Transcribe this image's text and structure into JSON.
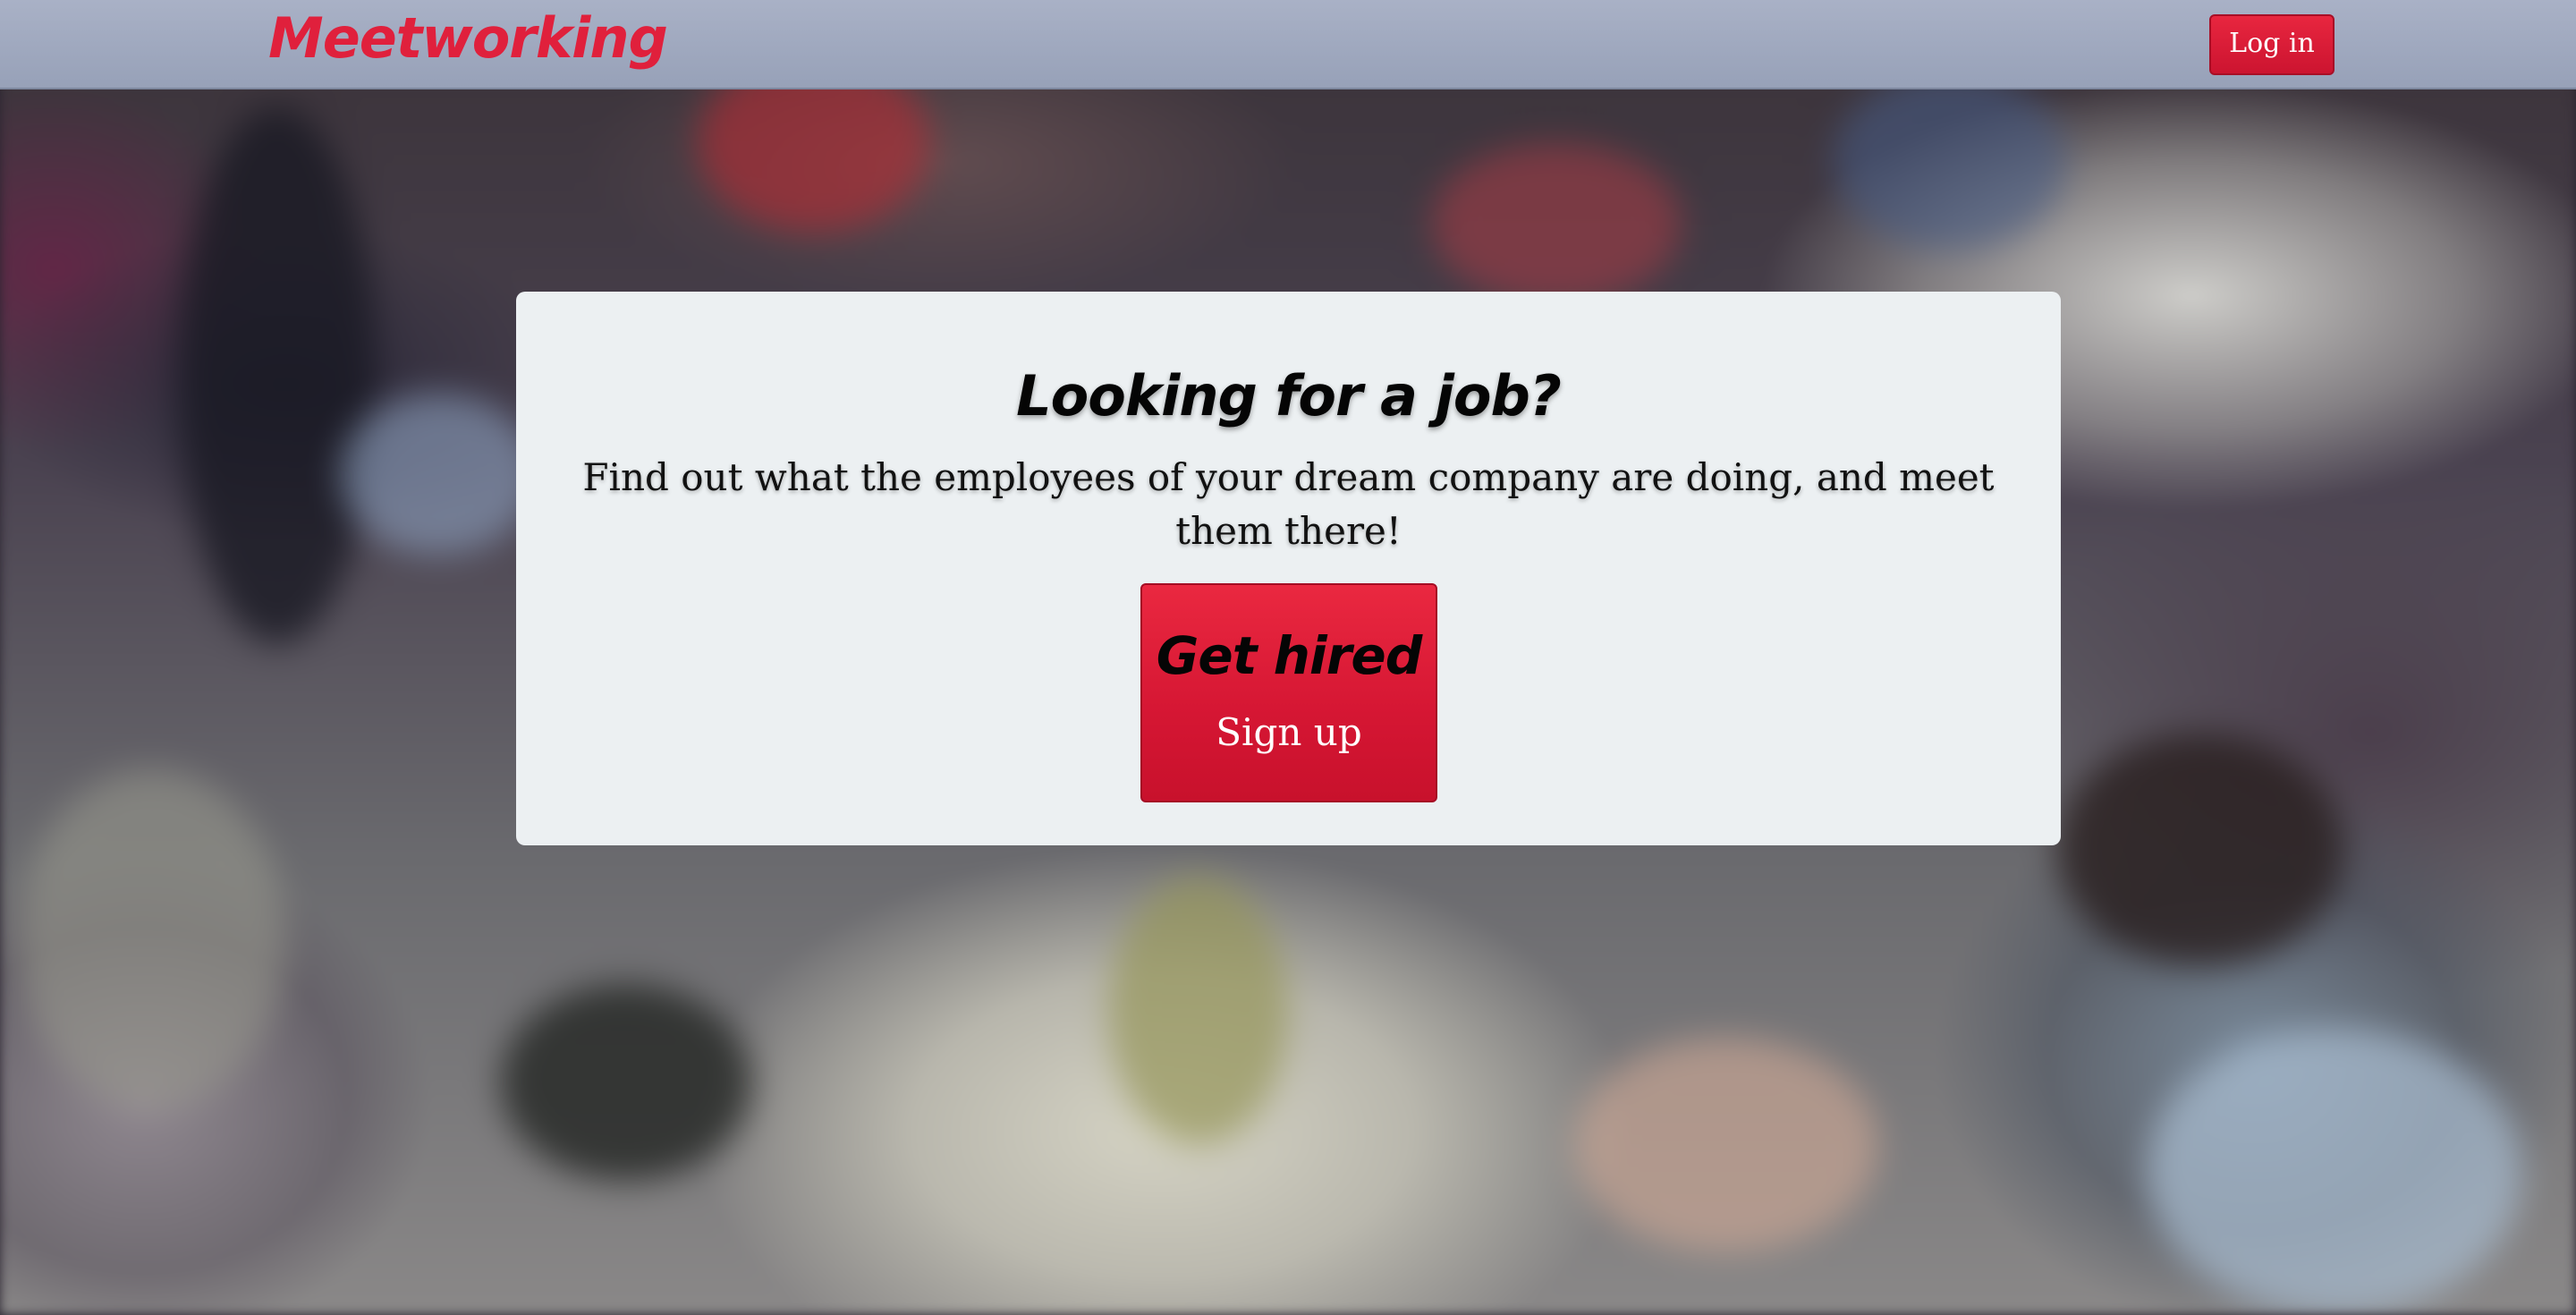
{
  "header": {
    "brand": "Meetworking",
    "login_label": "Log in"
  },
  "hero": {
    "title": "Looking for a job?",
    "subtitle": "Find out what the employees of your dream company are doing, and meet them there!",
    "cta_title": "Get hired",
    "cta_label": "Sign up"
  },
  "colors": {
    "brand": "#e0203c",
    "navbar": "#a3acc2",
    "card": "#ecf0f2",
    "button": "#dc1c36"
  }
}
